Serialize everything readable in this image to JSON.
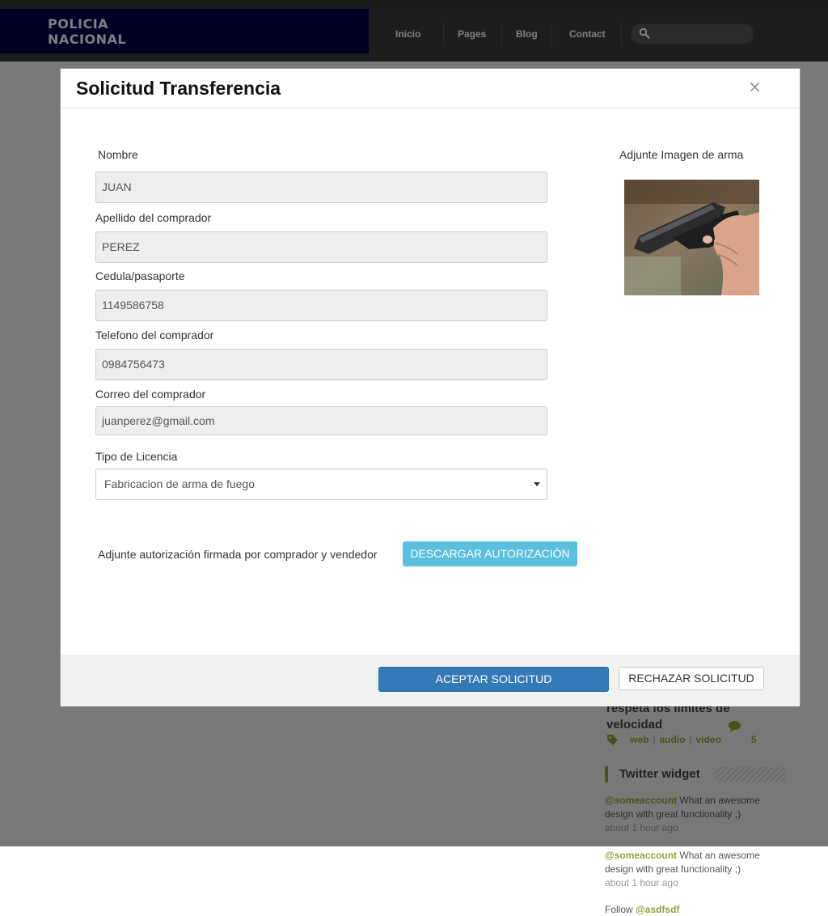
{
  "header": {
    "logo_line1": "POLICIA",
    "logo_line2": "NACIONAL",
    "nav": [
      "Inicio",
      "Pages",
      "Blog",
      "Contact"
    ],
    "search_placeholder": ""
  },
  "sidebar": {
    "post_title": "respeta los limites de velocidad",
    "tags": [
      "web",
      "audio",
      "video"
    ],
    "comment_count": "5",
    "widget_title": "Twitter widget",
    "tweets": [
      {
        "account": "@someaccount",
        "text": " What an awesome design with great functionality ;)",
        "time": "about 1 hour ago"
      },
      {
        "account": "@someaccount",
        "text": " What an awesome design with great functionality ;)",
        "time": "about 1 hour ago"
      }
    ],
    "follow_prefix": "Follow ",
    "follow_account": "@asdfsdf"
  },
  "modal": {
    "title": "Solicitud Transferencia",
    "close": "×",
    "fields": {
      "nombre_label": "Nombre",
      "nombre_value": "JUAN",
      "apellido_label": "Apellido del comprador",
      "apellido_value": "PEREZ",
      "cedula_label": "Cedula/pasaporte",
      "cedula_value": "1149586758",
      "telefono_label": "Telefono del comprador",
      "telefono_value": "0984756473",
      "correo_label": "Correo del comprador",
      "correo_value": "juanperez@gmail.com",
      "licencia_label": "Tipo de Licencia",
      "licencia_value": "Fabricacion de arma de fuego"
    },
    "image_label": "Adjunte Imagen de arma",
    "authorization_label": "Adjunte autorización firmada por comprador y vendedor",
    "download_button": "DESCARGAR AUTORIZACIÓN",
    "accept_button": "ACEPTAR SOLICITUD",
    "reject_button": "RECHAZAR SOLICITUD"
  },
  "colors": {
    "logo_bg": "#000047",
    "accent_green": "#8ca73a",
    "primary": "#337ab7",
    "info": "#5bc0de"
  }
}
